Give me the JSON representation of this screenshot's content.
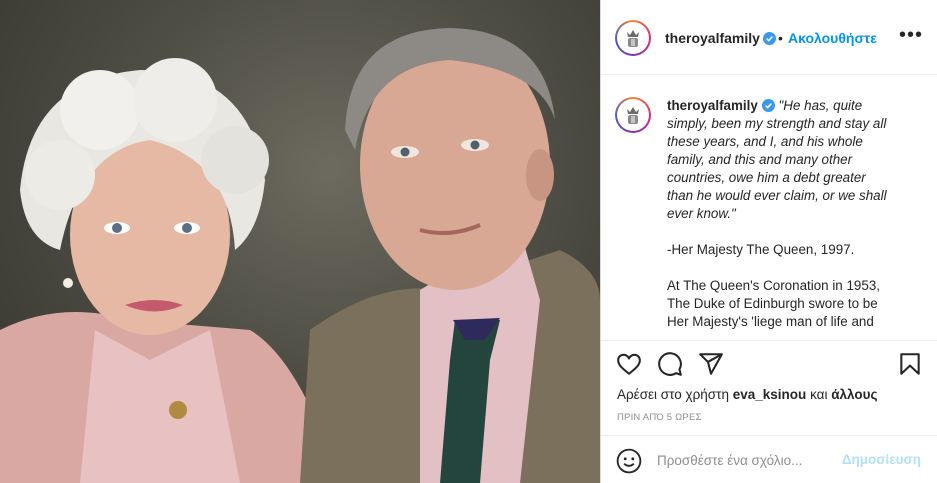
{
  "photo": {
    "alt_subject": "portrait"
  },
  "header": {
    "username": "theroyalfamily",
    "separator": "•",
    "follow_label": "Ακολουθήστε",
    "more_label": "•••"
  },
  "caption": {
    "username": "theroyalfamily",
    "lines": [
      "\"He has, quite",
      "simply, been my strength and stay all",
      "these years, and I, and his whole",
      "family, and this and many other",
      "countries, owe him a debt greater",
      "than he would ever claim, or we shall",
      "ever know.\""
    ],
    "attribution": "-Her Majesty The Queen, 1997.",
    "paragraph2": [
      "At The Queen's Coronation in 1953,",
      "The Duke of Edinburgh swore to be",
      "Her Majesty's 'liege man of life and"
    ]
  },
  "actions": {
    "icons": [
      "heart-icon",
      "comment-icon",
      "share-icon",
      "bookmark-icon"
    ],
    "likes_prefix": "Αρέσει στο χρήστη",
    "likes_user": "eva_ksinou",
    "likes_middle": "και",
    "likes_suffix": "άλλους",
    "time": "ΠΡΙΝ ΑΠΌ 5 ΩΡΕΣ"
  },
  "comment": {
    "placeholder": "Προσθέστε ένα σχόλιο...",
    "post_label": "Δημοσίευση"
  },
  "colors": {
    "link_blue": "#0095f6",
    "verified_blue": "#3897f0",
    "muted": "#8e8e8e",
    "post_disabled": "#b2dffc"
  }
}
